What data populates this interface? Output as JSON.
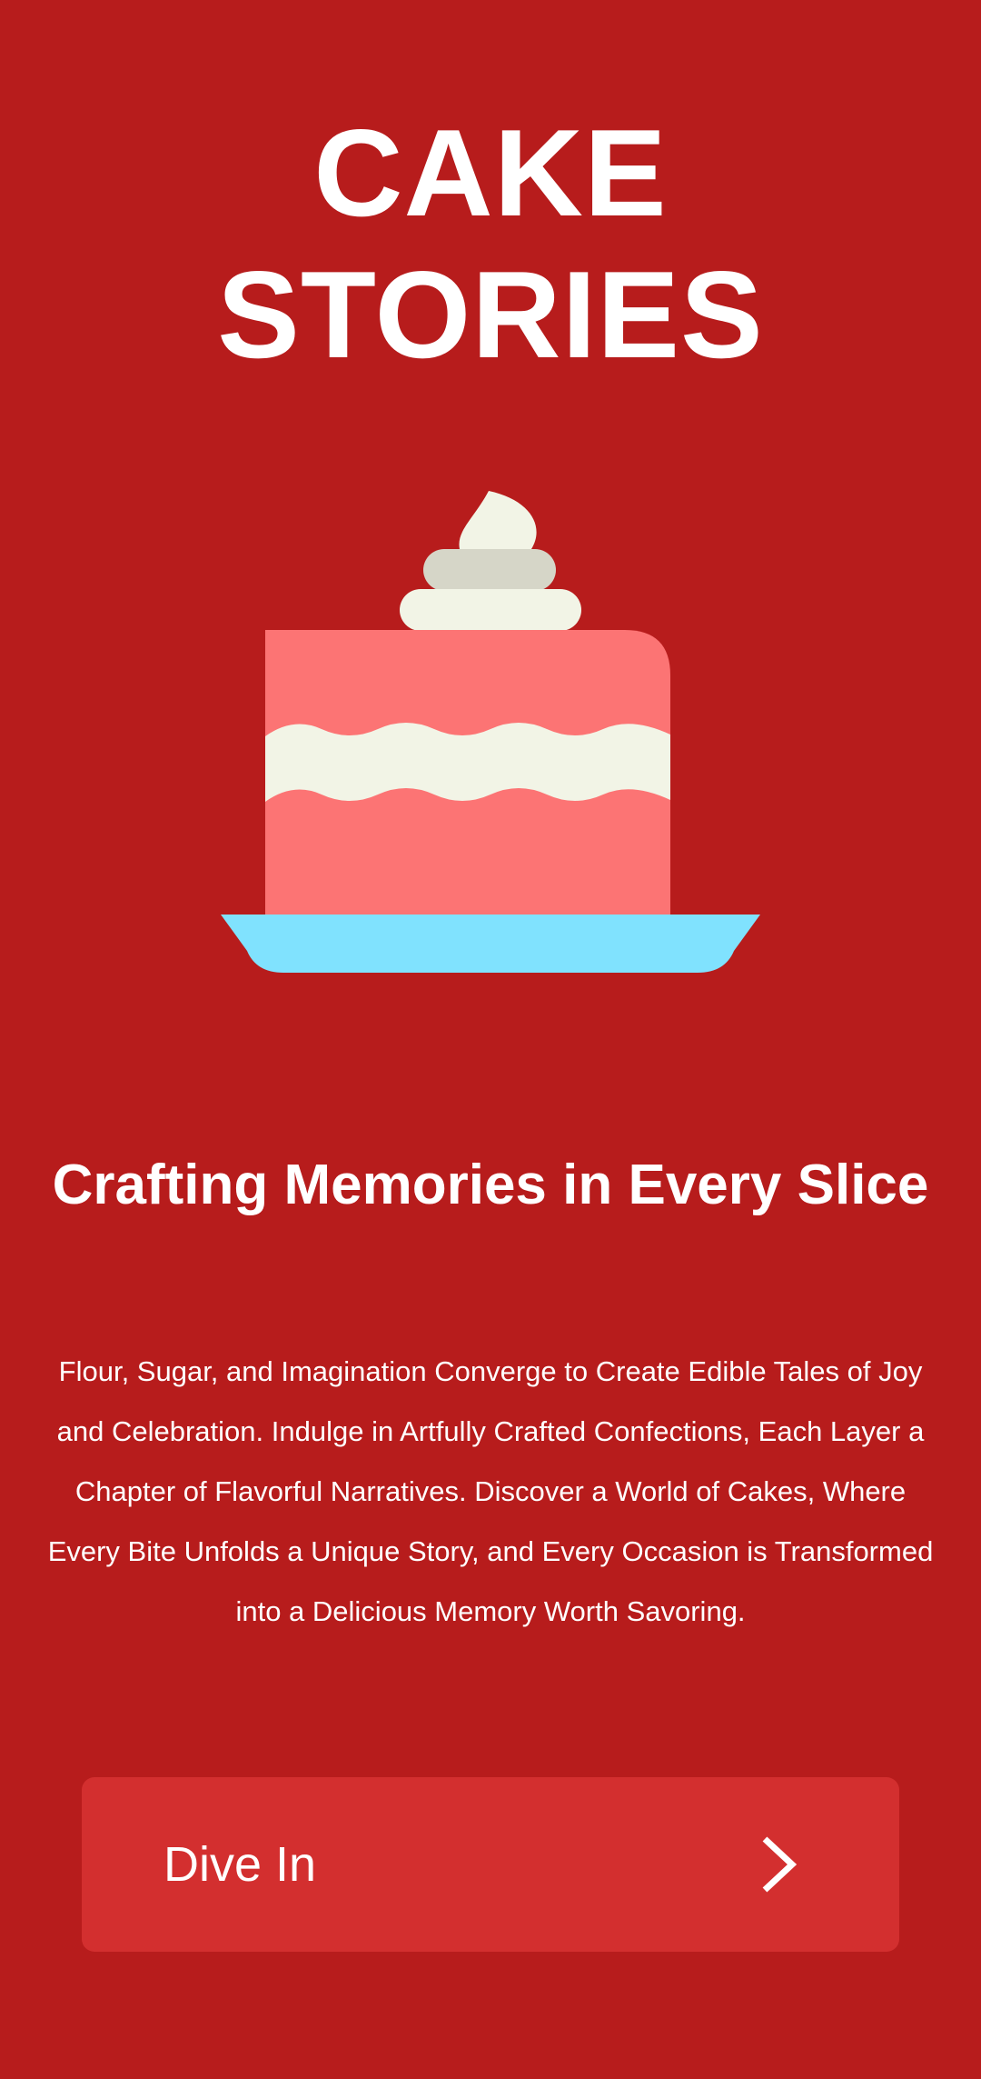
{
  "header": {
    "title_line1": "CAKE",
    "title_line2": "STORIES"
  },
  "hero": {
    "illustration": "cake-icon",
    "colors": {
      "background": "#b71c1c",
      "cake": "#fc7474",
      "cream": "#f2f4e6",
      "cream_shadow": "#d6d6c8",
      "plate": "#80e2fe"
    }
  },
  "main": {
    "tagline": "Crafting Memories in Every Slice",
    "description": "Flour, Sugar, and Imagination Converge to Create Edible Tales of Joy and Celebration. Indulge in Artfully Crafted Confections, Each Layer a Chapter of Flavorful Narratives. Discover a World of Cakes, Where Every Bite Unfolds a Unique Story, and Every Occasion is Transformed into a Delicious Memory Worth Savoring."
  },
  "cta": {
    "label": "Dive In",
    "icon": "chevron-right-icon",
    "color": "#d32f2f"
  }
}
